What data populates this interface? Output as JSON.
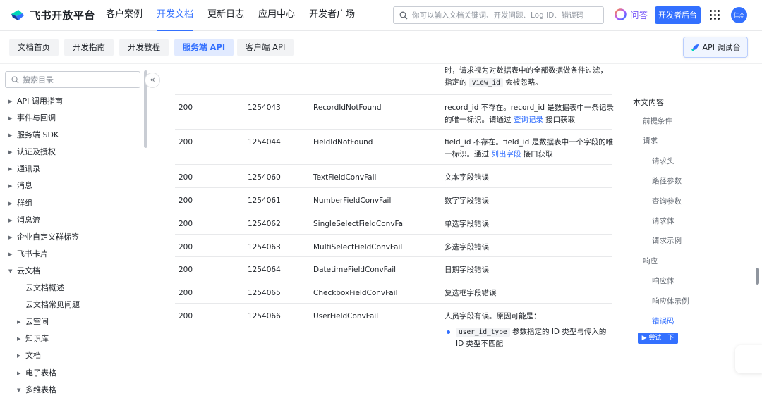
{
  "header": {
    "logo_text": "飞书开放平台",
    "nav": [
      "客户案例",
      "开发文档",
      "更新日志",
      "应用中心",
      "开发者广场"
    ],
    "search_placeholder": "你可以输入文档关键词、开发问题、Log ID、错误码",
    "ask_label": "问答",
    "dev_console_label": "开发者后台",
    "avatar_text": "仁杰"
  },
  "subnav": {
    "tabs": [
      "文档首页",
      "开发指南",
      "开发教程",
      "服务端 API",
      "客户端 API"
    ],
    "debug_label": "API 调试台"
  },
  "sidebar": {
    "search_placeholder": "搜索目录",
    "items": [
      {
        "label": "API 调用指南",
        "caret": "right",
        "level": 0
      },
      {
        "label": "事件与回调",
        "caret": "right",
        "level": 0
      },
      {
        "label": "服务端 SDK",
        "caret": "right",
        "level": 0
      },
      {
        "label": "认证及授权",
        "caret": "right",
        "level": 0
      },
      {
        "label": "通讯录",
        "caret": "right",
        "level": 0
      },
      {
        "label": "消息",
        "caret": "right",
        "level": 0
      },
      {
        "label": "群组",
        "caret": "right",
        "level": 0
      },
      {
        "label": "消息流",
        "caret": "right",
        "level": 0
      },
      {
        "label": "企业自定义群标签",
        "caret": "right",
        "level": 0
      },
      {
        "label": "飞书卡片",
        "caret": "right",
        "level": 0
      },
      {
        "label": "云文档",
        "caret": "down",
        "level": 0
      },
      {
        "label": "云文档概述",
        "caret": "",
        "level": 1
      },
      {
        "label": "云文档常见问题",
        "caret": "",
        "level": 1
      },
      {
        "label": "云空间",
        "caret": "right",
        "level": 1
      },
      {
        "label": "知识库",
        "caret": "right",
        "level": 1
      },
      {
        "label": "文档",
        "caret": "right",
        "level": 1
      },
      {
        "label": "电子表格",
        "caret": "right",
        "level": 1
      },
      {
        "label": "多维表格",
        "caret": "down",
        "level": 1
      }
    ]
  },
  "content": {
    "top_desc_1": "时，请求视为对数据表中的全部数据做条件过滤，",
    "top_desc_2a": "指定的",
    "top_desc_code": "view_id",
    "top_desc_2b": "会被忽略。",
    "rows": [
      {
        "http": "200",
        "code": "1254043",
        "name": "RecordIdNotFound",
        "desc_1": "record_id 不存在。record_id 是数据表中一条记录",
        "desc_2a": "的唯一标识。请通过 ",
        "desc_link": "查询记录",
        "desc_2b": " 接口获取"
      },
      {
        "http": "200",
        "code": "1254044",
        "name": "FieldIdNotFound",
        "desc_1": "field_id 不存在。field_id 是数据表中一个字段的唯",
        "desc_2a": "一标识。通过 ",
        "desc_link": "列出字段",
        "desc_2b": " 接口获取"
      },
      {
        "http": "200",
        "code": "1254060",
        "name": "TextFieldConvFail",
        "desc_1": "文本字段错误"
      },
      {
        "http": "200",
        "code": "1254061",
        "name": "NumberFieldConvFail",
        "desc_1": "数字字段错误"
      },
      {
        "http": "200",
        "code": "1254062",
        "name": "SingleSelectFieldConvFail",
        "desc_1": "单选字段错误"
      },
      {
        "http": "200",
        "code": "1254063",
        "name": "MultiSelectFieldConvFail",
        "desc_1": "多选字段错误"
      },
      {
        "http": "200",
        "code": "1254064",
        "name": "DatetimeFieldConvFail",
        "desc_1": "日期字段错误"
      },
      {
        "http": "200",
        "code": "1254065",
        "name": "CheckboxFieldConvFail",
        "desc_1": "复选框字段错误"
      },
      {
        "http": "200",
        "code": "1254066",
        "name": "UserFieldConvFail",
        "desc_1": "人员字段有误。原因可能是：",
        "bullet_code": "user_id_type",
        "bullet_text_1": " 参数指定的 ID 类型与传入的",
        "bullet_text_2": "ID 类型不匹配"
      }
    ]
  },
  "toc": {
    "title": "本文内容",
    "items": [
      {
        "label": "前提条件",
        "level": 0,
        "active": false
      },
      {
        "label": "请求",
        "level": 0,
        "active": false
      },
      {
        "label": "请求头",
        "level": 1,
        "active": false
      },
      {
        "label": "路径参数",
        "level": 1,
        "active": false
      },
      {
        "label": "查询参数",
        "level": 1,
        "active": false
      },
      {
        "label": "请求体",
        "level": 1,
        "active": false
      },
      {
        "label": "请求示例",
        "level": 1,
        "active": false
      },
      {
        "label": "响应",
        "level": 0,
        "active": false
      },
      {
        "label": "响应体",
        "level": 1,
        "active": false
      },
      {
        "label": "响应体示例",
        "level": 1,
        "active": false
      },
      {
        "label": "错误码",
        "level": 1,
        "active": true
      }
    ],
    "try_label": "▶ 尝试一下"
  },
  "colors": {
    "accent": "#3370ff",
    "text": "#1f2329",
    "muted": "#646a73"
  }
}
